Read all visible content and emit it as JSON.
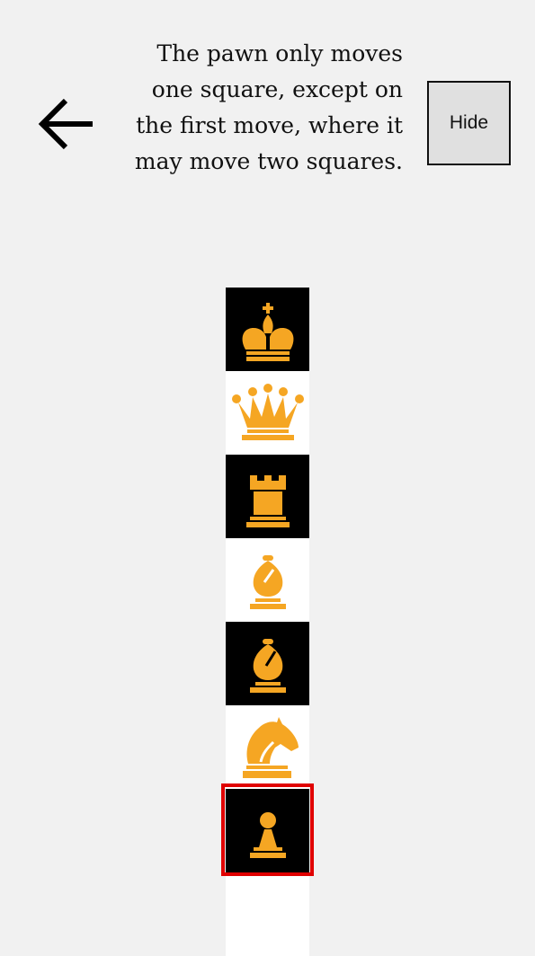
{
  "header": {
    "back_icon": "arrow-left-icon",
    "instruction": "The pawn only moves one square, except on the first move, where it may move two squares.",
    "hide_label": "Hide"
  },
  "board": {
    "piece_color": "#f5a623",
    "dark_square": "#000000",
    "light_square": "#ffffff",
    "selected_border": "#e00000",
    "squares": [
      {
        "piece": "king-icon",
        "shade": "dark"
      },
      {
        "piece": "queen-icon",
        "shade": "light"
      },
      {
        "piece": "rook-icon",
        "shade": "dark"
      },
      {
        "piece": "bishop-icon",
        "shade": "light"
      },
      {
        "piece": "bishop-icon",
        "shade": "dark"
      },
      {
        "piece": "knight-icon",
        "shade": "light"
      },
      {
        "piece": "pawn-icon",
        "shade": "dark",
        "selected": true
      },
      {
        "piece": null,
        "shade": "light"
      }
    ]
  }
}
